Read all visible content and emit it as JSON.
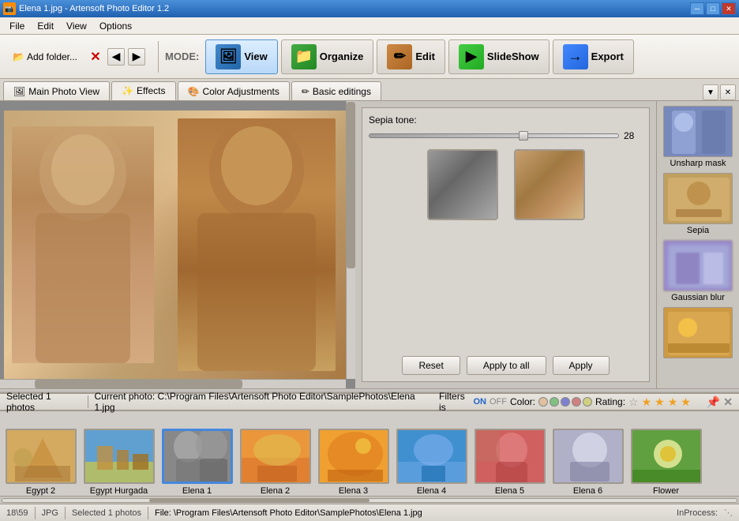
{
  "window": {
    "title": "Elena 1.jpg - Artensoft Photo Editor 1.2",
    "icon": "📷"
  },
  "titlebar": {
    "minimize": "─",
    "maximize": "□",
    "close": "✕"
  },
  "menubar": {
    "items": [
      "File",
      "Edit",
      "View",
      "Options"
    ]
  },
  "toolbar": {
    "mode_label": "MODE:",
    "buttons": [
      {
        "id": "view",
        "label": "View",
        "icon": "🖼"
      },
      {
        "id": "organize",
        "label": "Organize",
        "icon": "📁"
      },
      {
        "id": "edit",
        "label": "Edit",
        "icon": "✏"
      },
      {
        "id": "slideshow",
        "label": "SlideShow",
        "icon": "▶"
      },
      {
        "id": "export",
        "label": "Export",
        "icon": "→"
      }
    ],
    "add_folder": "Add folder...",
    "delete": "✕"
  },
  "secondary_toolbar": {
    "add_folder_label": "Add folder...",
    "nav_back": "◀",
    "nav_forward": "▶"
  },
  "tabs": {
    "items": [
      {
        "id": "main-photo-view",
        "label": "Main Photo View",
        "icon": "🖼",
        "active": false
      },
      {
        "id": "effects",
        "label": "Effects",
        "icon": "✨",
        "active": true
      },
      {
        "id": "color-adjustments",
        "label": "Color Adjustments",
        "icon": "🎨",
        "active": false
      },
      {
        "id": "basic-editings",
        "label": "Basic editings",
        "icon": "✏",
        "active": false
      }
    ]
  },
  "effects_panel": {
    "sepia_label": "Sepia tone:",
    "slider_value": "28",
    "reset_btn": "Reset",
    "apply_all_btn": "Apply to all",
    "apply_btn": "Apply"
  },
  "effects_sidebar": {
    "items": [
      {
        "id": "unsharp-mask",
        "label": "Unsharp mask",
        "style": "unsharp"
      },
      {
        "id": "sepia",
        "label": "Sepia",
        "style": "sepia"
      },
      {
        "id": "gaussian-blur",
        "label": "Gaussian blur",
        "style": "gaussian"
      },
      {
        "id": "effect-4",
        "label": "",
        "style": "last"
      }
    ]
  },
  "status_bar": {
    "selected": "Selected 1 photos",
    "current_photo": "Current photo: C:\\Program Files\\Artensoft Photo Editor\\SamplePhotos\\Elena 1.jpg",
    "filters_label": "Filters is",
    "filters_on": "ON",
    "filters_off": "OFF",
    "color_label": "Color:",
    "rating_label": "Rating:"
  },
  "filmstrip": {
    "items": [
      {
        "id": "egypt2",
        "label": "Egypt 2",
        "style": "egypt2",
        "selected": false
      },
      {
        "id": "egypt-hurgada",
        "label": "Egypt Hurgada",
        "style": "hurgada",
        "selected": false
      },
      {
        "id": "elena1",
        "label": "Elena 1",
        "style": "elena1",
        "selected": true
      },
      {
        "id": "elena2",
        "label": "Elena 2",
        "style": "elena2",
        "selected": false
      },
      {
        "id": "elena3",
        "label": "Elena 3",
        "style": "elena3",
        "selected": false
      },
      {
        "id": "elena4",
        "label": "Elena 4",
        "style": "elena4",
        "selected": false
      },
      {
        "id": "elena5",
        "label": "Elena 5",
        "style": "elena5",
        "selected": false
      },
      {
        "id": "elena6",
        "label": "Elena 6",
        "style": "elena6",
        "selected": false
      },
      {
        "id": "flower",
        "label": "Flower",
        "style": "flower",
        "selected": false
      }
    ]
  },
  "bottom_bar": {
    "coords": "18\\59",
    "format": "JPG",
    "selected": "Selected 1 photos",
    "file_path": "File: \\Program Files\\Artensoft Photo Editor\\SamplePhotos\\Elena 1.jpg",
    "inprocess": "InProcess:"
  }
}
